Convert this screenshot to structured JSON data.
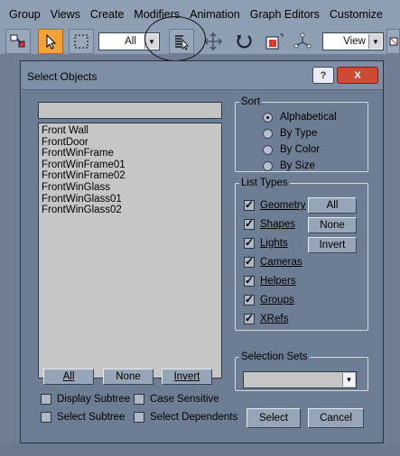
{
  "menu": [
    "Group",
    "Views",
    "Create",
    "Modifiers",
    "Animation",
    "Graph Editors",
    "Customize"
  ],
  "toolbar": {
    "filter_value": "All",
    "view_value": "View",
    "icons": [
      "select-link-icon",
      "select-object-icon",
      "select-region-icon",
      "select-by-name-icon",
      "move-icon",
      "rotate-icon",
      "scale-icon",
      "pivot-icon"
    ]
  },
  "dialog": {
    "title": "Select Objects",
    "help": "?",
    "close": "X",
    "filter_text": "",
    "objects": [
      "Front Wall",
      "FrontDoor",
      "FrontWinFrame",
      "FrontWinFrame01",
      "FrontWinFrame02",
      "FrontWinGlass",
      "FrontWinGlass01",
      "FrontWinGlass02"
    ],
    "buttons": {
      "all": "All",
      "none": "None",
      "invert": "Invert",
      "select": "Select",
      "cancel": "Cancel"
    },
    "options": {
      "display_subtree": "Display Subtree",
      "case_sensitive": "Case Sensitive",
      "select_subtree": "Select Subtree",
      "select_dependents": "Select Dependents"
    },
    "sort": {
      "label": "Sort",
      "items": [
        "Alphabetical",
        "By Type",
        "By Color",
        "By Size"
      ],
      "selected": "Alphabetical"
    },
    "list_types": {
      "label": "List Types",
      "items": [
        "Geometry",
        "Shapes",
        "Lights",
        "Cameras",
        "Helpers",
        "Groups",
        "XRefs"
      ],
      "all": "All",
      "none": "None",
      "invert": "Invert"
    },
    "selection_sets": {
      "label": "Selection Sets",
      "value": ""
    }
  },
  "colors": {
    "accent_active": "#f3a23a",
    "close_button": "#cf4a35",
    "dialog_bg": "#6d7d94"
  }
}
